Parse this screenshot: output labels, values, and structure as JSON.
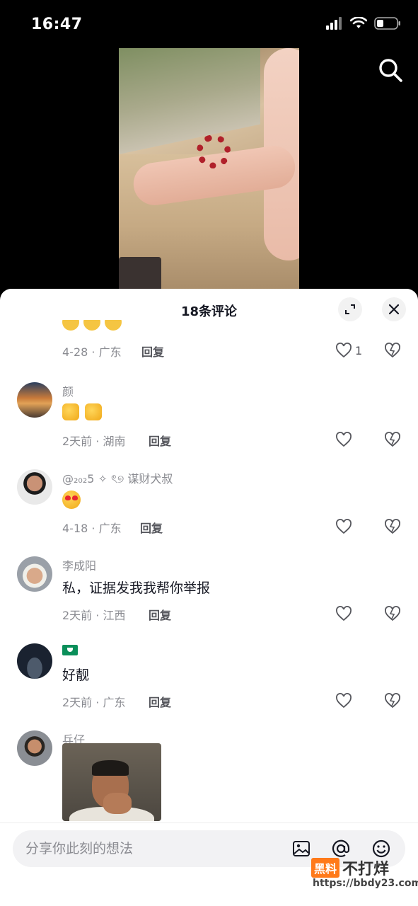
{
  "status_bar": {
    "time": "16:47"
  },
  "sheet": {
    "title": "18条评论"
  },
  "first_comment": {
    "text_fragment": "…",
    "date_location": "4-28 · 广东",
    "reply": "回复",
    "likes": "1"
  },
  "comments": [
    {
      "username": "颜",
      "date_location": "2天前 · 湖南",
      "reply": "回复"
    },
    {
      "username": "@₂₀₂5 ✧ ৎ୭ 谋财犬叔",
      "date_location": "4-18 · 广东",
      "reply": "回复"
    },
    {
      "username": "李成阳",
      "text": "私，证据发我我帮你举报",
      "date_location": "2天前 · 江西",
      "reply": "回复"
    },
    {
      "username": "",
      "text": "好靓",
      "date_location": "2天前 · 广东",
      "reply": "回复"
    },
    {
      "username": "兵仔"
    }
  ],
  "input": {
    "placeholder": "分享你此刻的想法"
  },
  "watermark": {
    "badge": "黑料",
    "text": "不打烊",
    "url": "https://bbdy23.com"
  },
  "colors": {
    "accent": "#fe2c55",
    "secondary_text": "#8a8b91"
  }
}
